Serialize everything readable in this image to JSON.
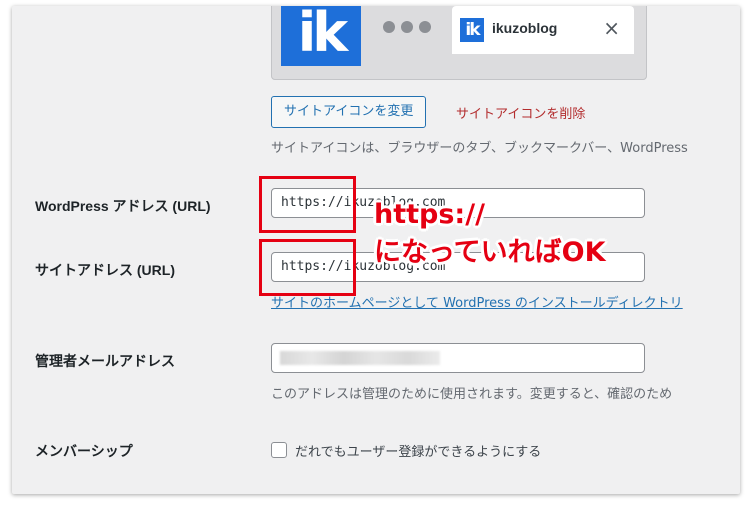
{
  "site_icon": {
    "logo_text": "ik",
    "browser_tab": {
      "title": "ikuzoblog",
      "close_glyph": "×"
    },
    "change_button": "サイトアイコンを変更",
    "delete_link": "サイトアイコンを削除",
    "description": "サイトアイコンは、ブラウザーのタブ、ブックマークバー、WordPress"
  },
  "wordpress_address": {
    "label": "WordPress アドレス (URL)",
    "value": "https://ikuzoblog.com"
  },
  "site_address": {
    "label": "サイトアドレス (URL)",
    "value": "https://ikuzoblog.com",
    "description_link": "サイトのホームページとして WordPress のインストールディレクトリ"
  },
  "admin_email": {
    "label": "管理者メールアドレス",
    "value": "",
    "description": "このアドレスは管理のために使用されます。変更すると、確認のため"
  },
  "membership": {
    "label": "メンバーシップ",
    "checkbox_label": "だれでもユーザー登録ができるようにする",
    "checked": false
  },
  "annotation": {
    "line1": "https://",
    "line2": "になっていればOK",
    "color": "#e50012"
  },
  "colors": {
    "accent": "#2271b1",
    "danger": "#b32d2e",
    "logo_blue": "#1e6fd9"
  }
}
